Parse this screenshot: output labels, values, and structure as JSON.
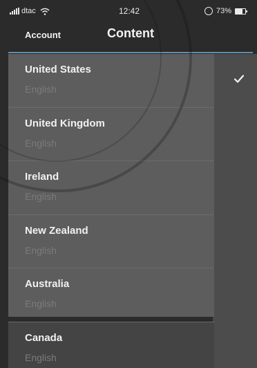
{
  "status_bar": {
    "carrier": "dtac",
    "time": "12:42",
    "battery": "73%"
  },
  "nav": {
    "back_label": "Account",
    "title": "Content"
  },
  "countries": [
    {
      "name": "United States",
      "language": "English",
      "selected": true
    },
    {
      "name": "United Kingdom",
      "language": "English",
      "selected": false
    },
    {
      "name": "Ireland",
      "language": "English",
      "selected": false
    },
    {
      "name": "New Zealand",
      "language": "English",
      "selected": false
    },
    {
      "name": "Australia",
      "language": "English",
      "selected": false
    },
    {
      "name": "Canada",
      "language": "English",
      "selected": false
    }
  ],
  "colors": {
    "divider_accent": "#5f8fb0"
  }
}
